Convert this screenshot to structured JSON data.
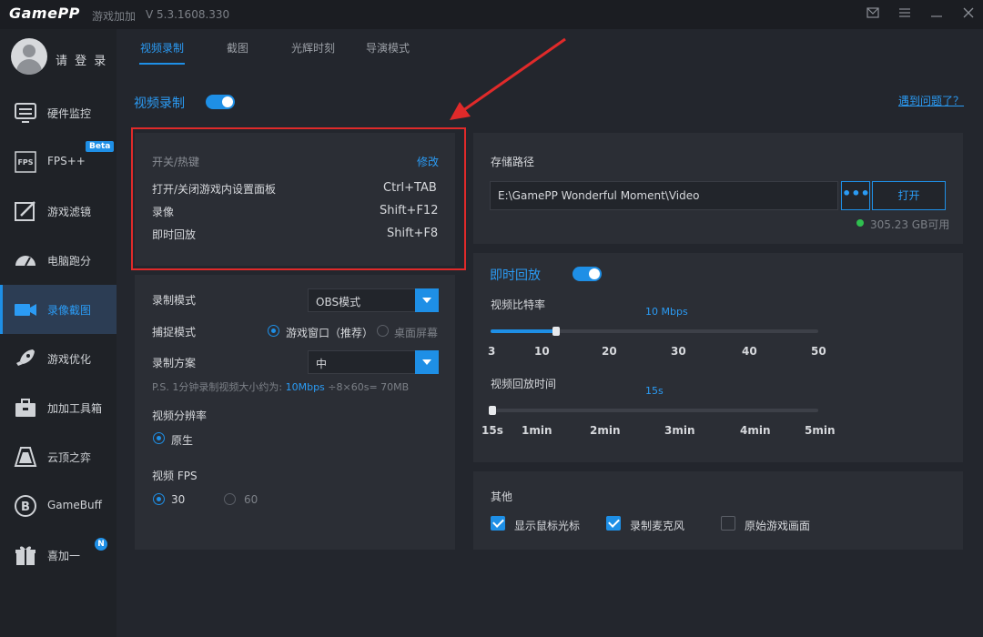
{
  "app": {
    "logo": "GamePP",
    "subtitle": "游戏加加",
    "version": "V 5.3.1608.330"
  },
  "sidebar": {
    "login": "请 登 录",
    "items": [
      {
        "label": "硬件监控"
      },
      {
        "label": "FPS++",
        "badge": "Beta"
      },
      {
        "label": "游戏滤镜"
      },
      {
        "label": "电脑跑分"
      },
      {
        "label": "录像截图",
        "active": true
      },
      {
        "label": "游戏优化"
      },
      {
        "label": "加加工具箱"
      },
      {
        "label": "云顶之弈"
      },
      {
        "label": "GameBuff"
      },
      {
        "label": "喜加一",
        "badge": "N"
      }
    ]
  },
  "tabs": [
    "视频录制",
    "截图",
    "光辉时刻",
    "导演模式"
  ],
  "video_record": {
    "title": "视频录制",
    "help_link": "遇到问题了？"
  },
  "hotkeys": {
    "label": "开关/热键",
    "edit": "修改",
    "rows": [
      {
        "name": "打开/关闭游戏内设置面板",
        "key": "Ctrl+TAB"
      },
      {
        "name": "录像",
        "key": "Shift+F12"
      },
      {
        "name": "即时回放",
        "key": "Shift+F8"
      }
    ]
  },
  "settings": {
    "record_mode_label": "录制模式",
    "record_mode_value": "OBS模式",
    "capture_mode_label": "捕捉模式",
    "capture_opt1": "游戏窗口（推荐）",
    "capture_opt2": "桌面屏幕",
    "scheme_label": "录制方案",
    "scheme_value": "中",
    "ps_prefix": "P.S. 1分钟录制视频大小约为:",
    "ps_rate": "10Mbps",
    "ps_suffix": "÷8×60s= 70MB",
    "resolution_label": "视频分辨率",
    "resolution_opt": "原生",
    "fps_label": "视频 FPS",
    "fps_opt1": "30",
    "fps_opt2": "60"
  },
  "storage": {
    "label": "存储路径",
    "path": "E:\\GamePP Wonderful Moment\\Video",
    "dots": "•••",
    "open": "打开",
    "free": "305.23 GB可用"
  },
  "replay": {
    "title": "即时回放",
    "bitrate_label": "视频比特率",
    "bitrate_value": "10 Mbps",
    "bitrate_ticks": [
      "3",
      "10",
      "20",
      "30",
      "40",
      "50"
    ],
    "bitrate_level": 10,
    "duration_label": "视频回放时间",
    "duration_value": "15s",
    "duration_ticks": [
      "15s",
      "1min",
      "2min",
      "3min",
      "4min",
      "5min"
    ]
  },
  "other": {
    "label": "其他",
    "opt1": "显示鼠标光标",
    "opt2": "录制麦克风",
    "opt3": "原始游戏画面"
  },
  "colors": {
    "accent": "#1e8fe6",
    "annotation": "#e02a2a",
    "bg": "#23262d",
    "panel": "#2b2e35"
  }
}
